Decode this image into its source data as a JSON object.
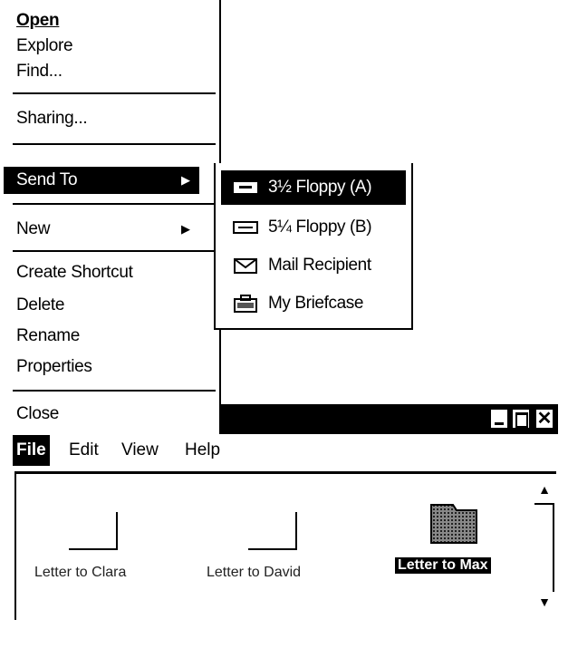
{
  "context_menu": {
    "items": [
      {
        "label": "Open",
        "underline": "O",
        "bold": true
      },
      {
        "label": "Explore",
        "underline": "x"
      },
      {
        "label": "Find...",
        "underline": "F"
      },
      {
        "label": "Sharing...",
        "underline": "h"
      },
      {
        "label": "Send To",
        "underline": "d",
        "submenu": true,
        "highlighted": true
      },
      {
        "label": "New",
        "underline": "w",
        "submenu": true
      },
      {
        "label": "Create Shortcut",
        "underline": "S"
      },
      {
        "label": "Delete",
        "underline": "D"
      },
      {
        "label": "Rename",
        "underline": "m"
      },
      {
        "label": "Properties",
        "underline": "r"
      },
      {
        "label": "Close",
        "underline": "C"
      }
    ]
  },
  "send_to_submenu": {
    "items": [
      {
        "label": "3½ Floppy (A)",
        "icon": "floppy-drive-icon",
        "highlighted": true
      },
      {
        "label": "5¼ Floppy (B)",
        "icon": "floppy-drive-icon"
      },
      {
        "label": "Mail Recipient",
        "icon": "mail-envelope-icon"
      },
      {
        "label": "My Briefcase",
        "icon": "briefcase-icon"
      }
    ]
  },
  "window": {
    "menubar": [
      "File",
      "Edit",
      "View",
      "Help"
    ],
    "files": [
      {
        "name": "Letter to Clara",
        "selected": false
      },
      {
        "name": "Letter to David",
        "selected": false
      },
      {
        "name": "Letter to Max",
        "selected": true
      }
    ]
  }
}
